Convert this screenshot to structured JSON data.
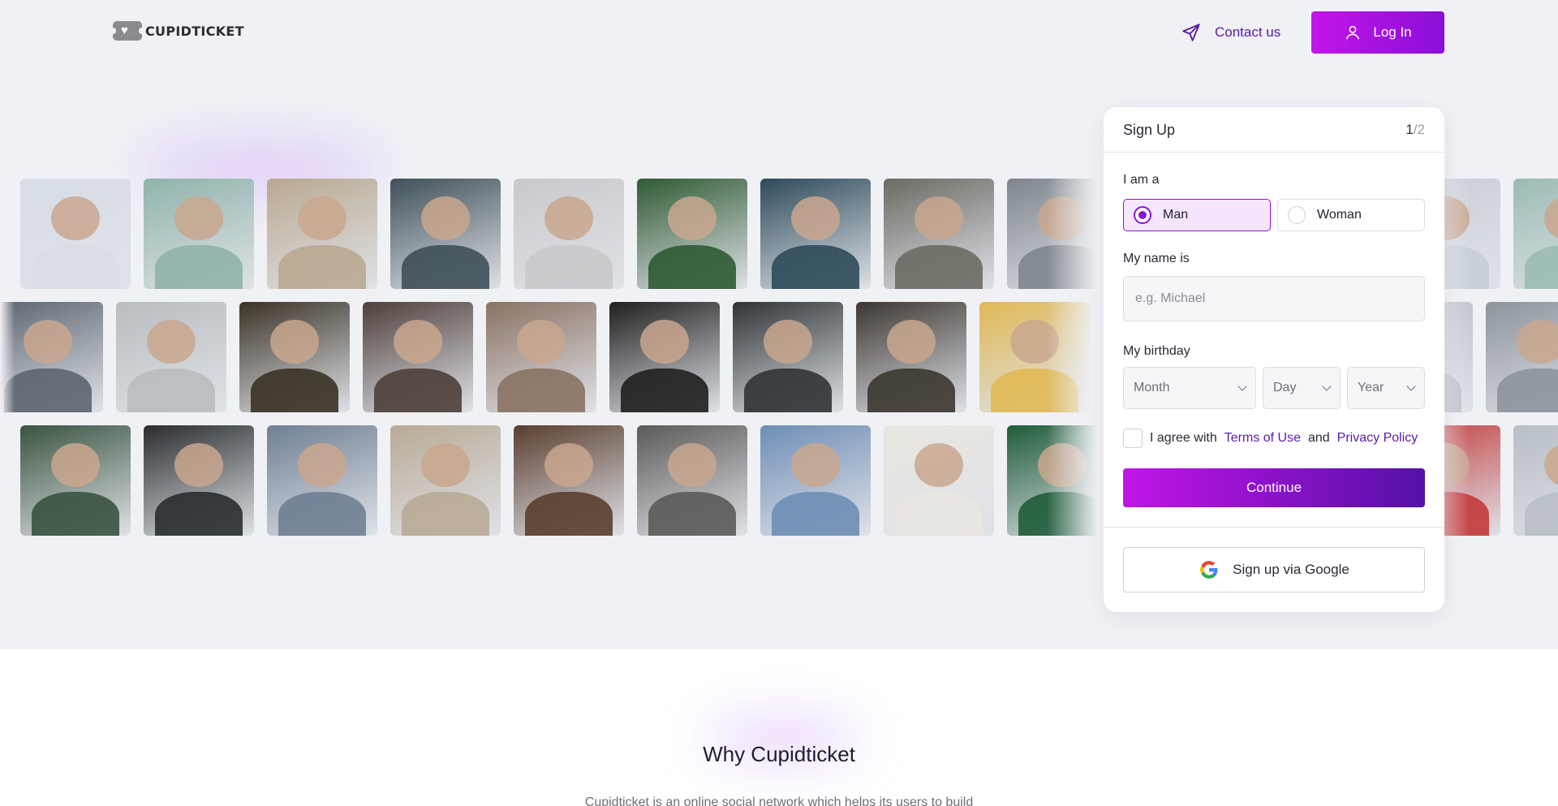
{
  "header": {
    "logo_text": "CUPIDTICKET",
    "contact_label": "Contact us",
    "login_label": "Log In"
  },
  "photo_grid": {
    "rows": [
      [
        "#d7dde6",
        "#8fb3ab",
        "#b9a890",
        "#3f4f58",
        "#c9c9cc",
        "#2f5a33",
        "#2d4a5a",
        "#6b6a63",
        "#7e858c",
        "#c8ced6",
        "#9bbbb5"
      ],
      [
        "#5c6570",
        "#b9bcc0",
        "#3a3226",
        "#4e3f3a",
        "#8a7263",
        "#1f1f1f",
        "#2f3438",
        "#3d3631",
        "#e0b955",
        "#b7bcc4",
        "#8d949b"
      ],
      [
        "#39533f",
        "#2a2c2f",
        "#6f7f93",
        "#b8aa96",
        "#5a3e2f",
        "#5c5a58",
        "#6e8eb5",
        "#e9e6e0",
        "#1f5c3a",
        "#c33a3a",
        "#b8bec6",
        "#6f7a84"
      ]
    ]
  },
  "signup": {
    "title": "Sign Up",
    "step_current": "1",
    "step_total": "/2",
    "i_am_label": "I am a",
    "gender_man": "Man",
    "gender_woman": "Woman",
    "selected_gender": "Man",
    "name_label": "My name is",
    "name_placeholder": "e.g. Michael",
    "birthday_label": "My birthday",
    "month_placeholder": "Month",
    "day_placeholder": "Day",
    "year_placeholder": "Year",
    "agree_prefix": "I agree with",
    "terms_label": "Terms of Use",
    "agree_and": "and",
    "privacy_label": "Privacy Policy",
    "continue_label": "Continue",
    "google_label": "Sign up via Google"
  },
  "why": {
    "title": "Why Cupidticket",
    "text": "Cupidticket is an online social network which helps its users to build"
  },
  "colors": {
    "accent": "#c215e8",
    "accent_dark": "#5410a8",
    "link": "#5b1aa6",
    "hero_bg": "#f0f1f5"
  }
}
